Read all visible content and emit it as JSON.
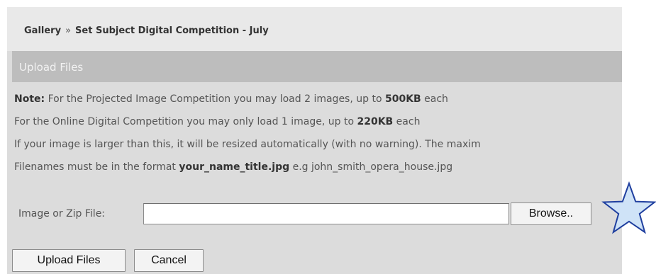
{
  "breadcrumb": {
    "root": "Gallery",
    "separator": "»",
    "current": "Set Subject Digital Competition - July"
  },
  "section": {
    "title": "Upload Files"
  },
  "notes": {
    "line1_prefix": "Note:",
    "line1_text": " For the Projected Image Competition you may load 2 images, up to ",
    "line1_size": "500KB",
    "line1_suffix": " each",
    "line2_text": "For the Online Digital Competition you may only load 1 image, up to ",
    "line2_size": "220KB",
    "line2_suffix": " each",
    "line3_text": "If your image is larger than this, it will be resized automatically (with no warning). The maxim",
    "line4_text": "Filenames must be in the format ",
    "line4_format": "your_name_title.jpg",
    "line4_example": " e.g john_smith_opera_house.jpg"
  },
  "form": {
    "file_label": "Image or Zip File:",
    "file_value": "",
    "browse_label": "Browse..",
    "upload_label": "Upload Files",
    "cancel_label": "Cancel"
  },
  "decoration": {
    "icon": "star-icon",
    "star_fill": "#cfe3f7",
    "star_stroke": "#1f3f9f"
  },
  "colors": {
    "panel_bg": "#dcdcdc",
    "header_bg": "#bdbdbd",
    "breadcrumb_bg": "#e9e9e9"
  }
}
